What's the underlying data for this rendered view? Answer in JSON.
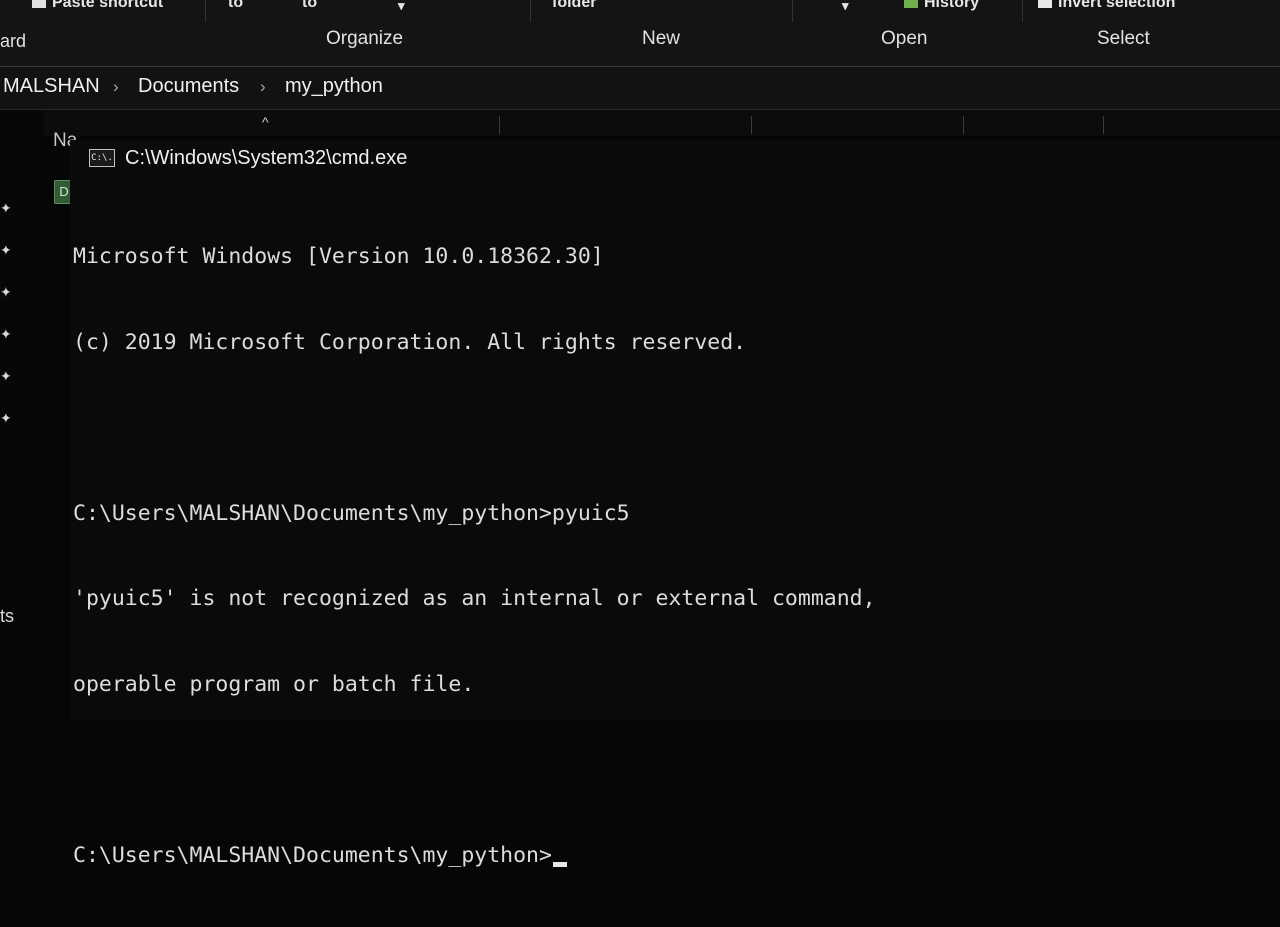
{
  "ribbon": {
    "top_items": [
      "Paste shortcut",
      "to",
      "to",
      "folder",
      "History",
      "Invert selection"
    ],
    "groups": [
      "ard",
      "Organize",
      "New",
      "Open",
      "Select"
    ]
  },
  "address": {
    "crumbs": [
      "MALSHAN",
      "Documents",
      "my_python"
    ],
    "separator": "›"
  },
  "file_list": {
    "name_header": "Na",
    "sort_indicator": "^"
  },
  "nav": {
    "partial_label": "ts"
  },
  "cmd": {
    "title": "C:\\Windows\\System32\\cmd.exe",
    "icon_text": "C:\\.",
    "lines": [
      "Microsoft Windows [Version 10.0.18362.30]",
      "(c) 2019 Microsoft Corporation. All rights reserved.",
      "",
      "C:\\Users\\MALSHAN\\Documents\\my_python>pyuic5",
      "'pyuic5' is not recognized as an internal or external command,",
      "operable program or batch file.",
      ""
    ],
    "prompt": "C:\\Users\\MALSHAN\\Documents\\my_python>"
  },
  "colors": {
    "console_bg": "#0a0a0a",
    "console_text": "#dcdcdc",
    "ribbon_bg": "#141414"
  }
}
